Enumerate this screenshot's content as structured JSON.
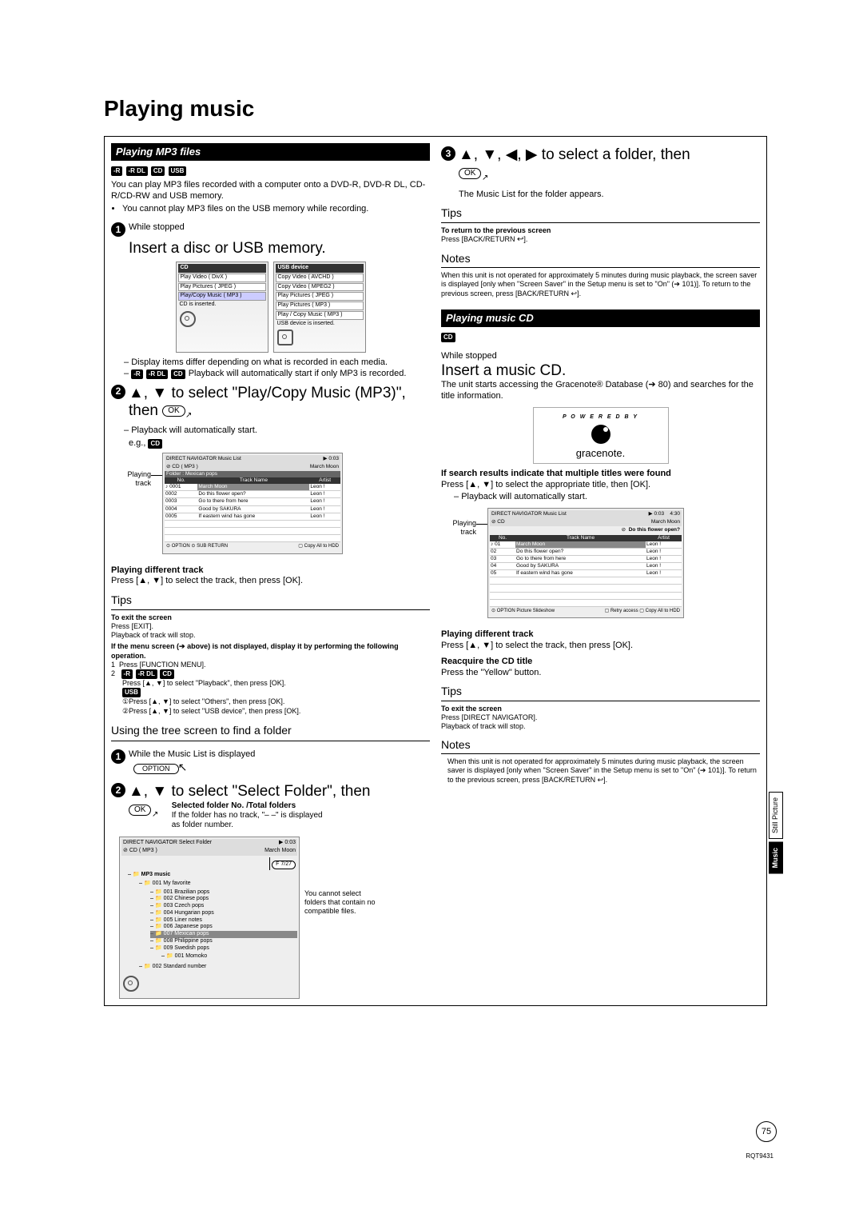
{
  "page_title": "Playing music",
  "sections": {
    "mp3": {
      "bar": "Playing MP3 files",
      "tags": [
        "-R",
        "-R DL",
        "CD",
        "USB"
      ],
      "intro1": "You can play MP3 files recorded with a computer onto a DVD-R, DVD-R DL, CD-R/CD-RW and USB memory.",
      "intro_bullet": "You cannot play MP3 files on the USB memory while recording.",
      "step1_label": "While stopped",
      "step1_big": "Insert a disc or USB memory.",
      "cd_menu_title": "CD",
      "usb_menu_title": "USB device",
      "cd_menu_items": [
        "Play Video ( DivX )",
        "Play Pictures ( JPEG )",
        "Play/Copy Music ( MP3 )",
        "CD is inserted."
      ],
      "usb_menu_items": [
        "Copy Video ( AVCHD )",
        "Copy Video ( MPEG2 )",
        "Play Pictures ( JPEG )",
        "Play Pictures ( MP3 )",
        "Play / Copy Music ( MP3 )",
        "USB device is inserted."
      ],
      "step1_dash1": "Display items differ depending on what is recorded in each media.",
      "step1_dash2_tags": [
        "-R",
        "-R DL",
        "CD"
      ],
      "step1_dash2_text": "Playback will automatically start if only MP3 is recorded.",
      "step2_text_a": "▲, ▼ to select \"Play/Copy Music (MP3)\", then",
      "ok_label": "OK",
      "step2_dash": "Playback will automatically start.",
      "eg_label": "e.g.,",
      "eg_tag": "CD",
      "playing_track_label": "Playing track",
      "nav_hdr1": "DIRECT NAVIGATOR   Music List",
      "nav_hdr2": "CD ( MP3 )",
      "nav_right_small": "0:03",
      "nav_right_small2": "March Moon",
      "nav_folder_row": "Folder : Mexican pops",
      "nav_cols": [
        "No.",
        "Track Name",
        "Artist"
      ],
      "nav_rows": [
        [
          "0001",
          "March Moon",
          "Leon !"
        ],
        [
          "0002",
          "Do this flower open?",
          "Leon !"
        ],
        [
          "0003",
          "Go to there from here",
          "Leon !"
        ],
        [
          "0004",
          "Good by SAKURA",
          "Leon !"
        ],
        [
          "0005",
          "If eastern wind has gone",
          "Leon !"
        ]
      ],
      "nav_footer": [
        "OPTION",
        "SUB",
        "RETURN",
        "Copy All to HDD"
      ],
      "pdt_heading": "Playing different track",
      "pdt_text": "Press [▲, ▼] to select the track, then press [OK].",
      "tips_heading": "Tips",
      "tip_exit_heading": "To exit the screen",
      "tip_exit_line1": "Press [EXIT].",
      "tip_exit_line2": "Playback of track will stop.",
      "tip_menu_heading": "If the menu screen (➔ above) is not displayed, display it by performing the following operation.",
      "tip_menu_1": "Press [FUNCTION MENU].",
      "tip_menu_2_tags": [
        "-R",
        "-R DL",
        "CD"
      ],
      "tip_menu_2_text": "Press [▲, ▼] to select \"Playback\", then press [OK].",
      "tip_menu_usb_tag": "USB",
      "tip_menu_usb_1": "①Press [▲, ▼] to select \"Others\", then press [OK].",
      "tip_menu_usb_2": "②Press [▲, ▼] to select \"USB device\", then press [OK].",
      "tree_subsection": "Using the tree screen to find a folder",
      "tree_step1": "While the Music List is displayed",
      "option_label": "OPTION",
      "tree_step2": "▲, ▼ to select \"Select Folder\", then",
      "sel_folder_heading": "Selected folder No. /Total folders",
      "sel_folder_text": "If the folder has no track, \"– –\" is displayed as folder number.",
      "tree_hdr": "DIRECT NAVIGATOR   Select Folder",
      "tree_hdr_right": "0:03",
      "tree_hdr_sub": "CD ( MP3 )",
      "tree_hdr_sub_r": "March Moon",
      "tree_badge": "F   7/27",
      "tree_root": "MP3 music",
      "tree_items": [
        "001 My favorite",
        "001 Brazilian pops",
        "002 Chinese pops",
        "003 Czech pops",
        "004 Hungarian pops",
        "005 Liner notes",
        "006 Japanese pops",
        "007 Mexican pops",
        "008 Philippine pops",
        "009 Swedish pops",
        "001 Momoko",
        "002 Standard number"
      ],
      "tree_annot": "You cannot select folders that contain no compatible files."
    },
    "folder_step3": {
      "text": "▲, ▼, ◀, ▶ to select a folder, then",
      "after": "The Music List for the folder appears.",
      "tips_heading": "Tips",
      "return_heading": "To return to the previous screen",
      "return_text": "Press [BACK/RETURN ",
      "return_icon": "↩",
      "return_text_end": "].",
      "notes_heading": "Notes",
      "notes_text": "When this unit is not operated for approximately 5 minutes during music playback, the screen saver is displayed [only when \"Screen Saver\" in the Setup menu is set to \"On\" (➔ 101)]. To return to the previous screen, press [BACK/RETURN ↩]."
    },
    "cd": {
      "bar": "Playing music CD",
      "tag": "CD",
      "while_stopped": "While stopped",
      "insert": "Insert a music CD.",
      "gracenote_text": "The unit starts accessing the Gracenote® Database (➔ 80) and searches for the title information.",
      "powered_by": "P O W E R E D   B Y",
      "gracenote_label": "gracenote.",
      "multi_heading": "If search results indicate that multiple titles were found",
      "multi_text": "Press [▲, ▼] to select the appropriate title, then [OK].",
      "multi_dash": "Playback will automatically start.",
      "nav_hdr1": "DIRECT NAVIGATOR   Music List",
      "nav_hdr2": "CD",
      "nav_right_small": "0:03",
      "nav_right_small2": "March Moon",
      "nav_right_small3": "4:30",
      "nav_cols": [
        "No.",
        "Track Name",
        "Artist"
      ],
      "nav_sel": "Do this flower open?",
      "nav_rows": [
        [
          "01",
          "March Moon",
          "Leon !"
        ],
        [
          "02",
          "Do this flower open?",
          "Leon !"
        ],
        [
          "03",
          "Go to there from here",
          "Leon !"
        ],
        [
          "04",
          "Good by SAKURA",
          "Leon !"
        ],
        [
          "05",
          "If eastern wind has gone",
          "Leon !"
        ]
      ],
      "nav_footer": [
        "OPTION",
        "Picture Slideshow",
        "Retry access",
        "Copy All to HDD"
      ],
      "playing_track_label": "Playing track",
      "pdt_heading": "Playing different track",
      "pdt_text": "Press [▲, ▼] to select the track, then press [OK].",
      "reacq_heading": "Reacquire the CD title",
      "reacq_text": "Press the \"Yellow\" button.",
      "tips_heading": "Tips",
      "exit_heading": "To exit the screen",
      "exit_1": "Press [DIRECT NAVIGATOR].",
      "exit_2": "Playback of track will stop.",
      "notes_heading": "Notes",
      "notes_text": "When this unit is not operated for approximately 5 minutes during music playback, the screen saver is displayed [only when \"Screen Saver\" in the Setup menu is set to \"On\" (➔ 101)]. To return to the previous screen, press [BACK/RETURN ↩]."
    }
  },
  "side_tabs": {
    "still": "Still Picture",
    "music": "Music"
  },
  "page_number": "75",
  "doc_code": "RQT9431"
}
